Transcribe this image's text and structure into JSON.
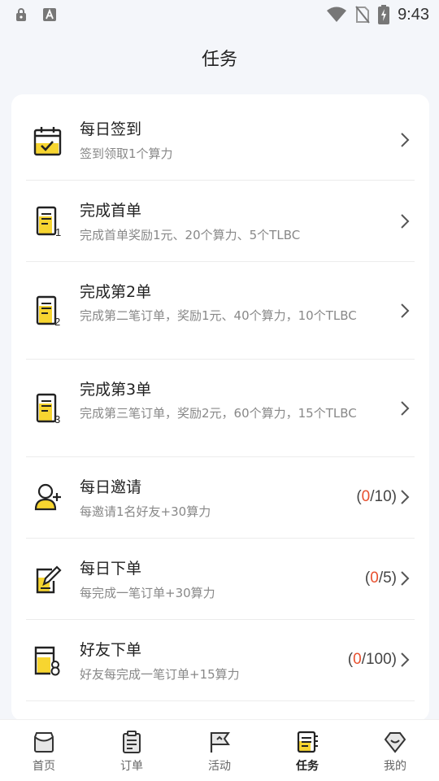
{
  "status": {
    "time": "9:43"
  },
  "header": {
    "title": "任务"
  },
  "tasks": [
    {
      "title": "每日签到",
      "desc": "签到领取1个算力",
      "icon": "calendar-check-icon"
    },
    {
      "title": "完成首单",
      "desc": "完成首单奖励1元、20个算力、5个TLBC",
      "icon": "document-1-icon"
    },
    {
      "title": "完成第2单",
      "desc": "完成第二笔订单，奖励1元、40个算力，10个TLBC",
      "icon": "document-2-icon"
    },
    {
      "title": "完成第3单",
      "desc": "完成第三笔订单，奖励2元，60个算力，15个TLBC",
      "icon": "document-3-icon"
    },
    {
      "title": "每日邀请",
      "desc": "每邀请1名好友+30算力",
      "icon": "user-add-icon",
      "progress": {
        "open": "(",
        "done": "0",
        "rest": "/10)"
      }
    },
    {
      "title": "每日下单",
      "desc": "每完成一笔订单+30算力",
      "icon": "edit-note-icon",
      "progress": {
        "open": "(",
        "done": "0",
        "rest": "/5)"
      }
    },
    {
      "title": "好友下单",
      "desc": "好友每完成一笔订单+15算力",
      "icon": "friend-order-icon",
      "progress": {
        "open": "(",
        "done": "0",
        "rest": "/100)"
      }
    }
  ],
  "tabs": [
    {
      "label": "首页",
      "icon": "home-bag-icon"
    },
    {
      "label": "订单",
      "icon": "clipboard-icon"
    },
    {
      "label": "活动",
      "icon": "flag-icon"
    },
    {
      "label": "任务",
      "icon": "task-note-icon",
      "active": true
    },
    {
      "label": "我的",
      "icon": "diamond-tag-icon"
    }
  ],
  "colors": {
    "accent": "#f7d530",
    "progress_done": "#e8502e",
    "bg": "#f4f6fa"
  }
}
